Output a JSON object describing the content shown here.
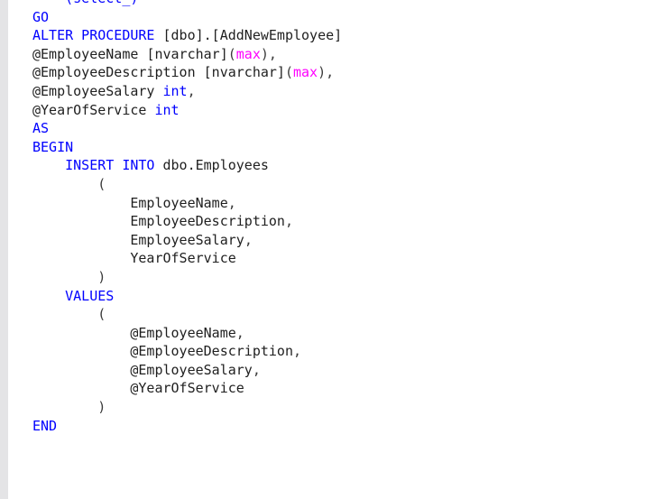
{
  "editor": {
    "kind": "sql-code-editor",
    "language": "T-SQL",
    "background_color": "#ffffff",
    "gutter_color": "#e4e4e6",
    "colors": {
      "keyword": "#0000ff",
      "type": "#0000ff",
      "parameter_literal": "#ff00ff",
      "identifier": "#1f1f1f",
      "punctuation": "#3a3a3a"
    },
    "font_size_px": 15,
    "line_height_px": 20.6
  },
  "code": {
    "partial_top_line": {
      "note": "clipped previous line, only glyph descenders visible",
      "text": ""
    },
    "lines": [
      {
        "indent": 1,
        "tokens": [
          {
            "t": "GO",
            "c": "kw"
          }
        ]
      },
      {
        "indent": 1,
        "tokens": [
          {
            "t": "ALTER PROCEDURE ",
            "c": "kw"
          },
          {
            "t": "[dbo].[AddNewEmployee]",
            "c": "ident"
          }
        ]
      },
      {
        "indent": 1,
        "tokens": [
          {
            "t": "@EmployeeName ",
            "c": "var"
          },
          {
            "t": "[nvarchar]",
            "c": "ident"
          },
          {
            "t": "(",
            "c": "punct"
          },
          {
            "t": "max",
            "c": "litparam"
          },
          {
            "t": "),",
            "c": "punct"
          }
        ]
      },
      {
        "indent": 1,
        "tokens": [
          {
            "t": "@EmployeeDescription ",
            "c": "var"
          },
          {
            "t": "[nvarchar]",
            "c": "ident"
          },
          {
            "t": "(",
            "c": "punct"
          },
          {
            "t": "max",
            "c": "litparam"
          },
          {
            "t": "),",
            "c": "punct"
          }
        ]
      },
      {
        "indent": 1,
        "tokens": [
          {
            "t": "@EmployeeSalary ",
            "c": "var"
          },
          {
            "t": "int",
            "c": "type"
          },
          {
            "t": ",",
            "c": "punct"
          }
        ]
      },
      {
        "indent": 1,
        "tokens": [
          {
            "t": "@YearOfService ",
            "c": "var"
          },
          {
            "t": "int",
            "c": "type"
          }
        ]
      },
      {
        "indent": 1,
        "tokens": [
          {
            "t": "AS",
            "c": "kw"
          }
        ]
      },
      {
        "indent": 1,
        "tokens": [
          {
            "t": "BEGIN",
            "c": "kw"
          }
        ]
      },
      {
        "indent": 1,
        "tokens": [
          {
            "t": "    ",
            "c": "plain"
          },
          {
            "t": "INSERT INTO ",
            "c": "kw"
          },
          {
            "t": "dbo.Employees",
            "c": "ident"
          }
        ]
      },
      {
        "indent": 1,
        "tokens": [
          {
            "t": "        (",
            "c": "punct"
          }
        ]
      },
      {
        "indent": 1,
        "tokens": [
          {
            "t": "            EmployeeName",
            "c": "ident"
          },
          {
            "t": ",",
            "c": "punct"
          }
        ]
      },
      {
        "indent": 1,
        "tokens": [
          {
            "t": "            EmployeeDescription",
            "c": "ident"
          },
          {
            "t": ",",
            "c": "punct"
          }
        ]
      },
      {
        "indent": 1,
        "tokens": [
          {
            "t": "            EmployeeSalary",
            "c": "ident"
          },
          {
            "t": ",",
            "c": "punct"
          }
        ]
      },
      {
        "indent": 1,
        "tokens": [
          {
            "t": "            YearOfService",
            "c": "ident"
          }
        ]
      },
      {
        "indent": 1,
        "tokens": [
          {
            "t": "        )",
            "c": "punct"
          }
        ]
      },
      {
        "indent": 1,
        "tokens": [
          {
            "t": "    ",
            "c": "plain"
          },
          {
            "t": "VALUES",
            "c": "kw"
          }
        ]
      },
      {
        "indent": 1,
        "tokens": [
          {
            "t": "        (",
            "c": "punct"
          }
        ]
      },
      {
        "indent": 1,
        "tokens": [
          {
            "t": "            @EmployeeName",
            "c": "var"
          },
          {
            "t": ",",
            "c": "punct"
          }
        ]
      },
      {
        "indent": 1,
        "tokens": [
          {
            "t": "            @EmployeeDescription",
            "c": "var"
          },
          {
            "t": ",",
            "c": "punct"
          }
        ]
      },
      {
        "indent": 1,
        "tokens": [
          {
            "t": "            @EmployeeSalary",
            "c": "var"
          },
          {
            "t": ",",
            "c": "punct"
          }
        ]
      },
      {
        "indent": 1,
        "tokens": [
          {
            "t": "            @YearOfService",
            "c": "var"
          }
        ]
      },
      {
        "indent": 1,
        "tokens": [
          {
            "t": "        )",
            "c": "punct"
          }
        ]
      },
      {
        "indent": 1,
        "tokens": [
          {
            "t": "END",
            "c": "kw"
          }
        ]
      }
    ]
  }
}
